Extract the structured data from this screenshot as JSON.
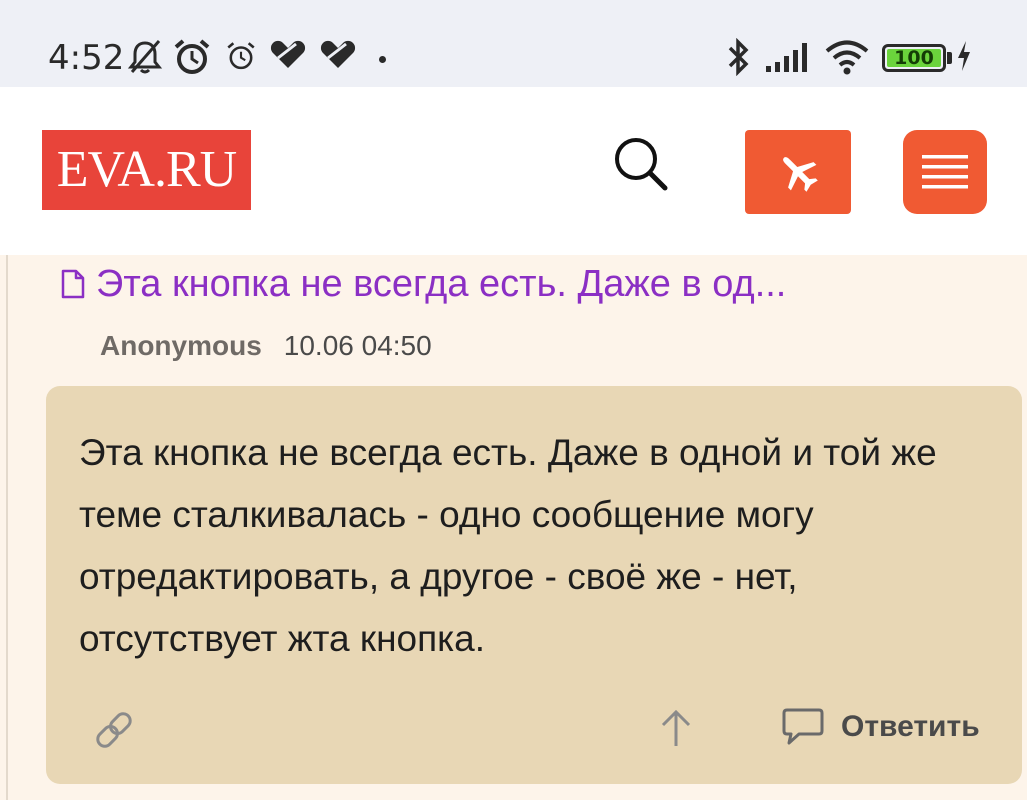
{
  "status_bar": {
    "time": "4:52",
    "battery_level": "100",
    "icons": [
      "mute-icon",
      "alarm-icon",
      "alarm-icon",
      "app-icon",
      "app-icon",
      "bluetooth-icon",
      "signal-icon",
      "wifi-icon",
      "battery-icon",
      "charging-icon"
    ]
  },
  "header": {
    "logo_text": "EVA.RU",
    "accent_color": "#f05a33",
    "logo_color": "#e8443a"
  },
  "post": {
    "title": "Эта кнопка не всегда есть. Даже в од...",
    "author": "Anonymous",
    "timestamp": "10.06 04:50",
    "message": "Эта кнопка не всегда есть. Даже в одной и той же теме сталкивалась - одно сообщение могу отредактировать, а другое - своё же - нет, отсутствует жта кнопка.",
    "reply_label": "Ответить",
    "title_color": "#8b2fc4",
    "card_color": "#e8d7b5"
  }
}
